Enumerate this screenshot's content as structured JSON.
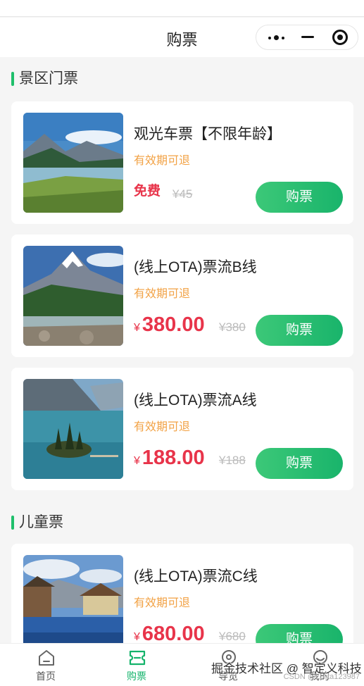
{
  "nav": {
    "title": "购票"
  },
  "sections": [
    {
      "title": "景区门票",
      "items": [
        {
          "name": "观光车票【不限年龄】",
          "tag": "有效期可退",
          "price_label": "免费",
          "currency": "",
          "price": "",
          "original": "¥45",
          "buy": "购票"
        },
        {
          "name": "(线上OTA)票流B线",
          "tag": "有效期可退",
          "price_label": "",
          "currency": "¥",
          "price": "380.00",
          "original": "¥380",
          "buy": "购票"
        },
        {
          "name": "(线上OTA)票流A线",
          "tag": "有效期可退",
          "price_label": "",
          "currency": "¥",
          "price": "188.00",
          "original": "¥188",
          "buy": "购票"
        }
      ]
    },
    {
      "title": "儿童票",
      "items": [
        {
          "name": "(线上OTA)票流C线",
          "tag": "有效期可退",
          "price_label": "",
          "currency": "¥",
          "price": "680.00",
          "original": "¥680",
          "buy": "购票"
        }
      ]
    }
  ],
  "tabbar": [
    {
      "label": "首页",
      "icon": "home-icon",
      "active": false
    },
    {
      "label": "购票",
      "icon": "ticket-icon",
      "active": true
    },
    {
      "label": "导览",
      "icon": "location-icon",
      "active": false
    },
    {
      "label": "我的",
      "icon": "user-icon",
      "active": false
    }
  ],
  "watermark": "掘金技术社区 @ 智定义科技",
  "watermark_small": "CSDN @Lolita123987",
  "colors": {
    "accent": "#1fbf6b",
    "price": "#e8344a",
    "tag": "#f2a245"
  }
}
